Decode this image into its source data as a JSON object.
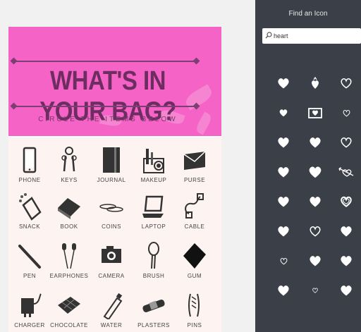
{
  "design": {
    "title": "WHAT'S IN YOUR BAG?",
    "subtitle": "CIRCLE THE ITEMS BELOW",
    "items": [
      {
        "label": "PHONE",
        "icon": "phone-icon"
      },
      {
        "label": "KEYS",
        "icon": "keys-icon"
      },
      {
        "label": "JOURNAL",
        "icon": "journal-icon"
      },
      {
        "label": "MAKEUP",
        "icon": "makeup-icon"
      },
      {
        "label": "PURSE",
        "icon": "purse-icon"
      },
      {
        "label": "SNACK",
        "icon": "snack-icon"
      },
      {
        "label": "BOOK",
        "icon": "book-icon"
      },
      {
        "label": "COINS",
        "icon": "coins-icon"
      },
      {
        "label": "LAPTOP",
        "icon": "laptop-icon"
      },
      {
        "label": "CABLE",
        "icon": "cable-icon"
      },
      {
        "label": "PEN",
        "icon": "pen-icon"
      },
      {
        "label": "EARPHONES",
        "icon": "earphones-icon"
      },
      {
        "label": "CAMERA",
        "icon": "camera-icon"
      },
      {
        "label": "BRUSH",
        "icon": "brush-icon"
      },
      {
        "label": "GUM",
        "icon": "gum-icon"
      },
      {
        "label": "CHARGER",
        "icon": "charger-icon"
      },
      {
        "label": "CHOCOLATE",
        "icon": "chocolate-icon"
      },
      {
        "label": "WATER",
        "icon": "water-bottle-icon"
      },
      {
        "label": "PLASTERS",
        "icon": "plasters-icon"
      },
      {
        "label": "PINS",
        "icon": "pins-icon"
      }
    ],
    "colors": {
      "pink": "#f463c5",
      "title": "#6e2d60",
      "items_bg": "#fdf3f1"
    }
  },
  "panel": {
    "title": "Find an Icon",
    "search": {
      "value": "heart",
      "placeholder": ""
    },
    "results": [
      "heart-solid-icon",
      "strawberry-heart-icon",
      "heart-outline-icon",
      "heart-small-solid-icon",
      "heart-envelope-icon",
      "heart-outline-small-icon",
      "heart-solid-icon",
      "heart-solid-icon",
      "heart-outline-icon",
      "heart-solid-icon",
      "heart-solid-large-icon",
      "heart-arrow-icon",
      "heart-solid-icon",
      "heart-solid-icon",
      "heart-double-outline-icon",
      "heart-solid-icon",
      "heart-outline-icon",
      "heart-solid-icon",
      "heart-outline-small-icon",
      "heart-solid-icon",
      "heart-solid-icon",
      "heart-solid-icon",
      "heart-small-outline-icon",
      "heart-solid-icon"
    ],
    "colors": {
      "bg": "#3b4048",
      "icon": "#ffffff"
    }
  }
}
